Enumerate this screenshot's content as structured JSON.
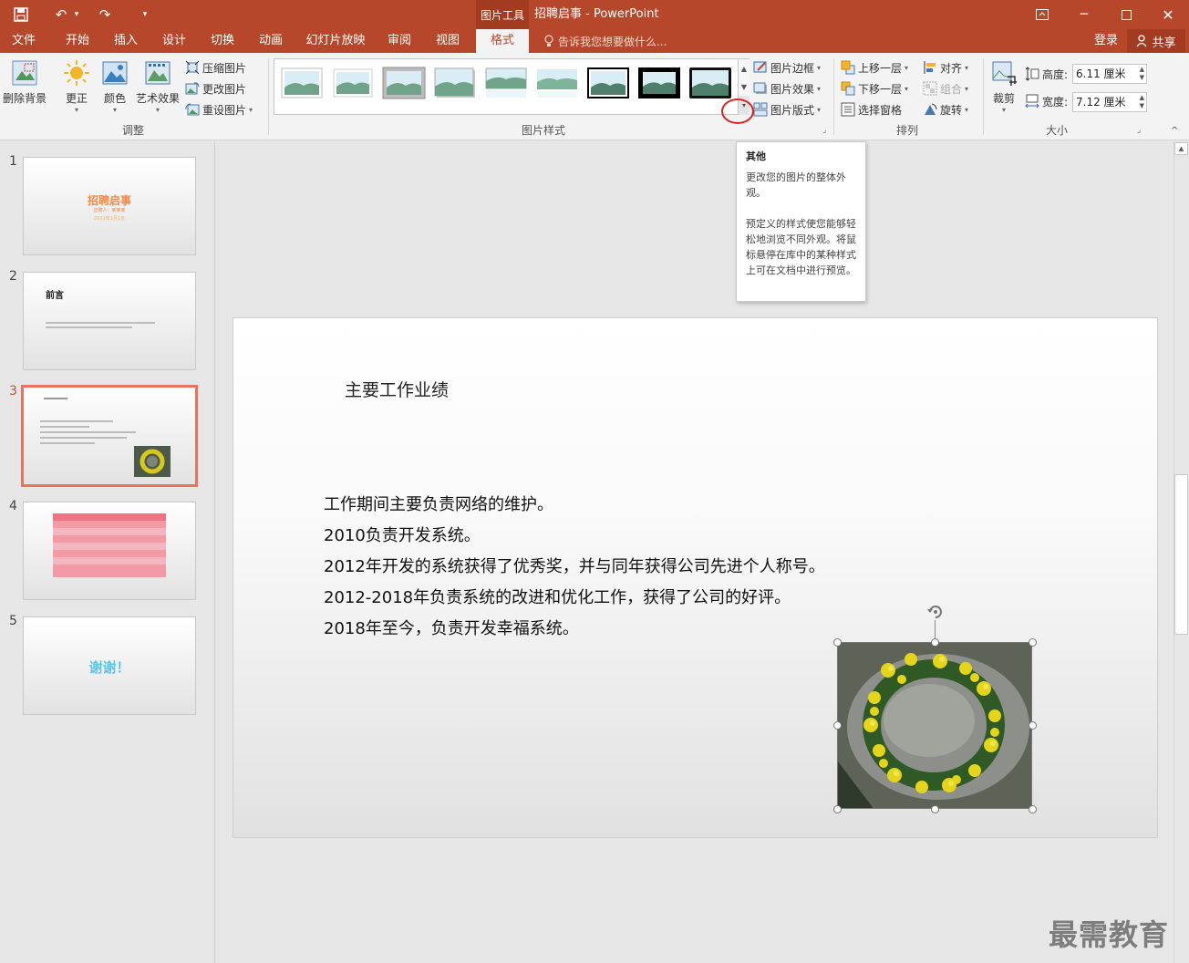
{
  "title_bar": {
    "context_tool": "图片工具",
    "doc_title": "招聘启事 - PowerPoint",
    "undo_dropdown": "▾",
    "customize": "▾"
  },
  "tabs": [
    {
      "label": "文件"
    },
    {
      "label": "开始"
    },
    {
      "label": "插入"
    },
    {
      "label": "设计"
    },
    {
      "label": "切换"
    },
    {
      "label": "动画"
    },
    {
      "label": "幻灯片放映"
    },
    {
      "label": "审阅"
    },
    {
      "label": "视图"
    },
    {
      "label": "格式",
      "active": true
    }
  ],
  "tell_me": "告诉我您想要做什么...",
  "login": "登录",
  "share": "共享",
  "ribbon": {
    "adjust": {
      "label": "调整",
      "remove_bg": "删除背景",
      "corrections": "更正",
      "color": "颜色",
      "artistic": "艺术效果",
      "compress": "压缩图片",
      "change": "更改图片",
      "reset": "重设图片"
    },
    "styles": {
      "label": "图片样式",
      "border": "图片边框",
      "effects": "图片效果",
      "layout": "图片版式"
    },
    "arrange": {
      "label": "排列",
      "bring_forward": "上移一层",
      "send_backward": "下移一层",
      "selection_pane": "选择窗格",
      "align": "对齐",
      "group": "组合",
      "rotate": "旋转"
    },
    "size": {
      "label": "大小",
      "crop": "裁剪",
      "height_label": "高度:",
      "height_value": "6.11 厘米",
      "width_label": "宽度:",
      "width_value": "7.12 厘米"
    }
  },
  "tooltip": {
    "title": "其他",
    "line1": "更改您的图片的整体外观。",
    "line2": "预定义的样式使您能够轻松地浏览不同外观。将鼠标悬停在库中的某种样式上可在文档中进行预览。"
  },
  "slides": [
    {
      "num": "1",
      "title": "招聘启事",
      "sub1": "应聘人：某某某",
      "sub2": "2021年1月1日"
    },
    {
      "num": "2",
      "title": "前言"
    },
    {
      "num": "3",
      "title": "主要工作业绩"
    },
    {
      "num": "4"
    },
    {
      "num": "5",
      "title": "谢谢！"
    }
  ],
  "slide": {
    "title": "主要工作业绩",
    "lines": [
      "工作期间主要负责网络的维护。",
      "2010负责开发系统。",
      "2012年开发的系统获得了优秀奖，并与同年获得公司先进个人称号。",
      "2012-2018年负责系统的改进和优化工作，获得了公司的好评。",
      "2018年至今，负责开发幸福系统。"
    ]
  },
  "watermark": "最需教育",
  "colors": {
    "accent": "#b7472a",
    "slide_active": "#e8735a",
    "thumb1_title": "#f0894f",
    "thumb4_table": "#ee7384",
    "thumb5_text": "#5bc8e8"
  }
}
